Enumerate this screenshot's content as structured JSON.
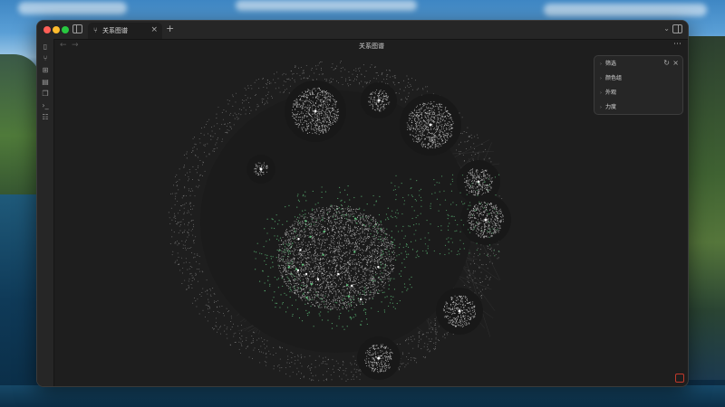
{
  "window": {
    "tab": {
      "label": "关系图谱",
      "icon": "graph-icon"
    },
    "page_title": "关系图谱"
  },
  "ribbon": [
    {
      "icon": "file-icon"
    },
    {
      "icon": "graph-icon"
    },
    {
      "icon": "canvas-icon"
    },
    {
      "icon": "calendar-icon"
    },
    {
      "icon": "copy-icon"
    },
    {
      "icon": "terminal-icon"
    },
    {
      "icon": "template-icon"
    }
  ],
  "filter_panel": {
    "items": [
      "筛选",
      "颜色组",
      "外观",
      "力度"
    ]
  },
  "colors": {
    "node": "#cfcfcf",
    "node_highlight": "#5fbf7a",
    "link": "#6d6d6d",
    "accent_corner": "#c0392b"
  }
}
